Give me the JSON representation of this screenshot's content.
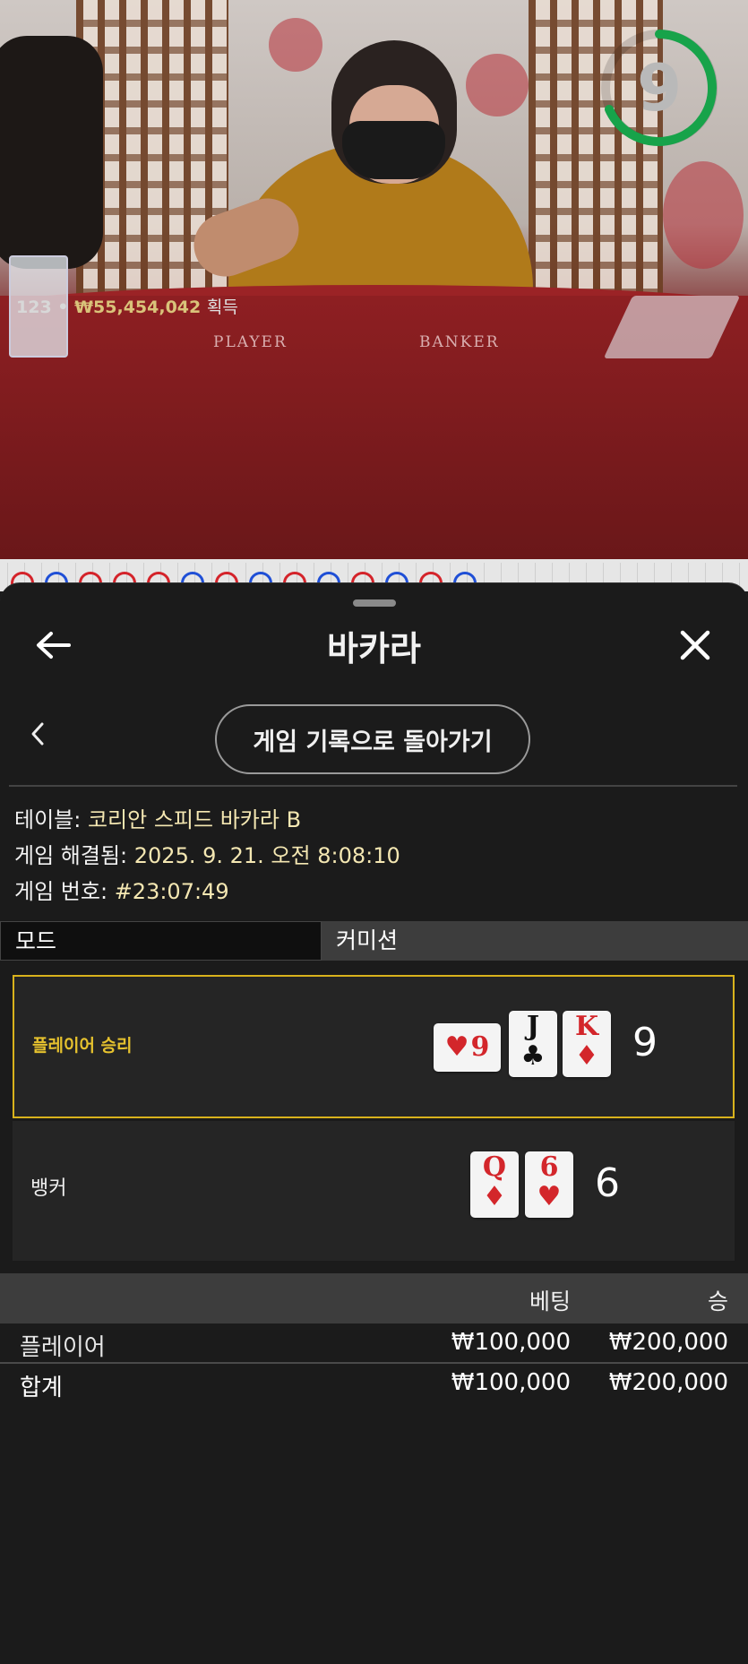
{
  "video": {
    "winner_count": "123",
    "winner_amount": "₩55,454,042",
    "winner_suffix": "획득",
    "timer": "9",
    "felt_player": "PLAYER",
    "felt_banker": "BANKER"
  },
  "header": {
    "title": "바카라",
    "back_icon": "arrow-left-icon",
    "close_icon": "close-icon"
  },
  "history_button": "게임 기록으로 돌아가기",
  "info": {
    "table_label": "테이블:",
    "table_value": "코리안 스피드 바카라 B",
    "resolved_label": "게임 해결됨:",
    "resolved_value": "2025. 9. 21. 오전 8:08:10",
    "game_no_label": "게임 번호:",
    "game_no_value": "#23:07:49"
  },
  "tabs": {
    "mode": "모드",
    "commission": "커미션"
  },
  "results": {
    "player": {
      "label": "플레이어 승리",
      "cards": [
        {
          "rank": "9",
          "suit": "♥",
          "color": "red"
        },
        {
          "rank": "J",
          "suit": "♣",
          "color": "black"
        },
        {
          "rank": "K",
          "suit": "♦",
          "color": "red"
        }
      ],
      "score": "9"
    },
    "banker": {
      "label": "뱅커",
      "cards": [
        {
          "rank": "Q",
          "suit": "♦",
          "color": "red"
        },
        {
          "rank": "6",
          "suit": "♥",
          "color": "red"
        }
      ],
      "score": "6"
    }
  },
  "bets": {
    "col_bet": "베팅",
    "col_win": "승",
    "rows": [
      {
        "name": "플레이어",
        "bet": "₩100,000",
        "win": "₩200,000"
      }
    ],
    "total": {
      "name": "합계",
      "bet": "₩100,000",
      "win": "₩200,000"
    }
  },
  "colors": {
    "accent_gold": "#d8b21c",
    "info_value": "#f4e7b2",
    "timer_ring": "#17a34a",
    "road_red": "#d4232a",
    "road_blue": "#1f4fd6"
  }
}
